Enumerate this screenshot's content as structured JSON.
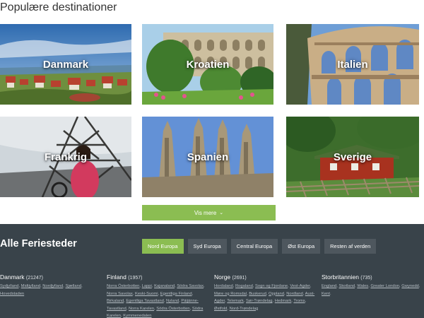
{
  "page": {
    "title": "Populære destinationer"
  },
  "destinations": [
    {
      "label": "Danmark"
    },
    {
      "label": "Kroatien"
    },
    {
      "label": "Italien"
    },
    {
      "label": "Frankrig"
    },
    {
      "label": "Spanien"
    },
    {
      "label": "Sverige"
    }
  ],
  "more_button": {
    "label": "Vis mere",
    "icon": "chevron-down-icon"
  },
  "all_destinations": {
    "title": "Alle Feriesteder",
    "tabs": [
      {
        "label": "Nord Europa",
        "active": true
      },
      {
        "label": "Syd Europa",
        "active": false
      },
      {
        "label": "Central Europa",
        "active": false
      },
      {
        "label": "Øst Europa",
        "active": false
      },
      {
        "label": "Resten af verden",
        "active": false
      }
    ],
    "countries": [
      {
        "name": "Danmark",
        "count": "(21247)",
        "regions": [
          "Sydjylland",
          "Midtjylland",
          "Nordjylland",
          "Sjælland",
          "Hovedstaden"
        ]
      },
      {
        "name": "Finland",
        "count": "(1957)",
        "regions": [
          "Norra Österbotten",
          "Lappi",
          "Kajanaland",
          "Södra Savolax",
          "Norra Savolax",
          "Keski-Suomi",
          "Egentliga Finland",
          "Birkaland",
          "Egentliga Tavastland",
          "Nyland",
          "Päijänne-Tavastland",
          "Norra Karelen",
          "Södra Österbotten",
          "Södra Karelen",
          "Kymmenedalen"
        ]
      },
      {
        "name": "Norge",
        "count": "(2691)",
        "regions": [
          "Hordaland",
          "Rogaland",
          "Sogn og Fjordane",
          "Vest-Agder",
          "Møre og Romsdal",
          "Buskerud",
          "Oppland",
          "Nordland",
          "Aust-Agder",
          "Telemark",
          "Sør-Trøndelag",
          "Hedmark",
          "Troms",
          "Østfold",
          "Nord-Trøndelag"
        ]
      },
      {
        "name": "Storbritannien",
        "count": "(735)",
        "regions": [
          "England",
          "Skotland",
          "Wales",
          "Greater London",
          "Gwynedd",
          "Kent"
        ]
      }
    ]
  },
  "colors": {
    "accent_green": "#8bbd52",
    "footer_bg": "#39434a",
    "tab_bg": "#4e575e"
  }
}
